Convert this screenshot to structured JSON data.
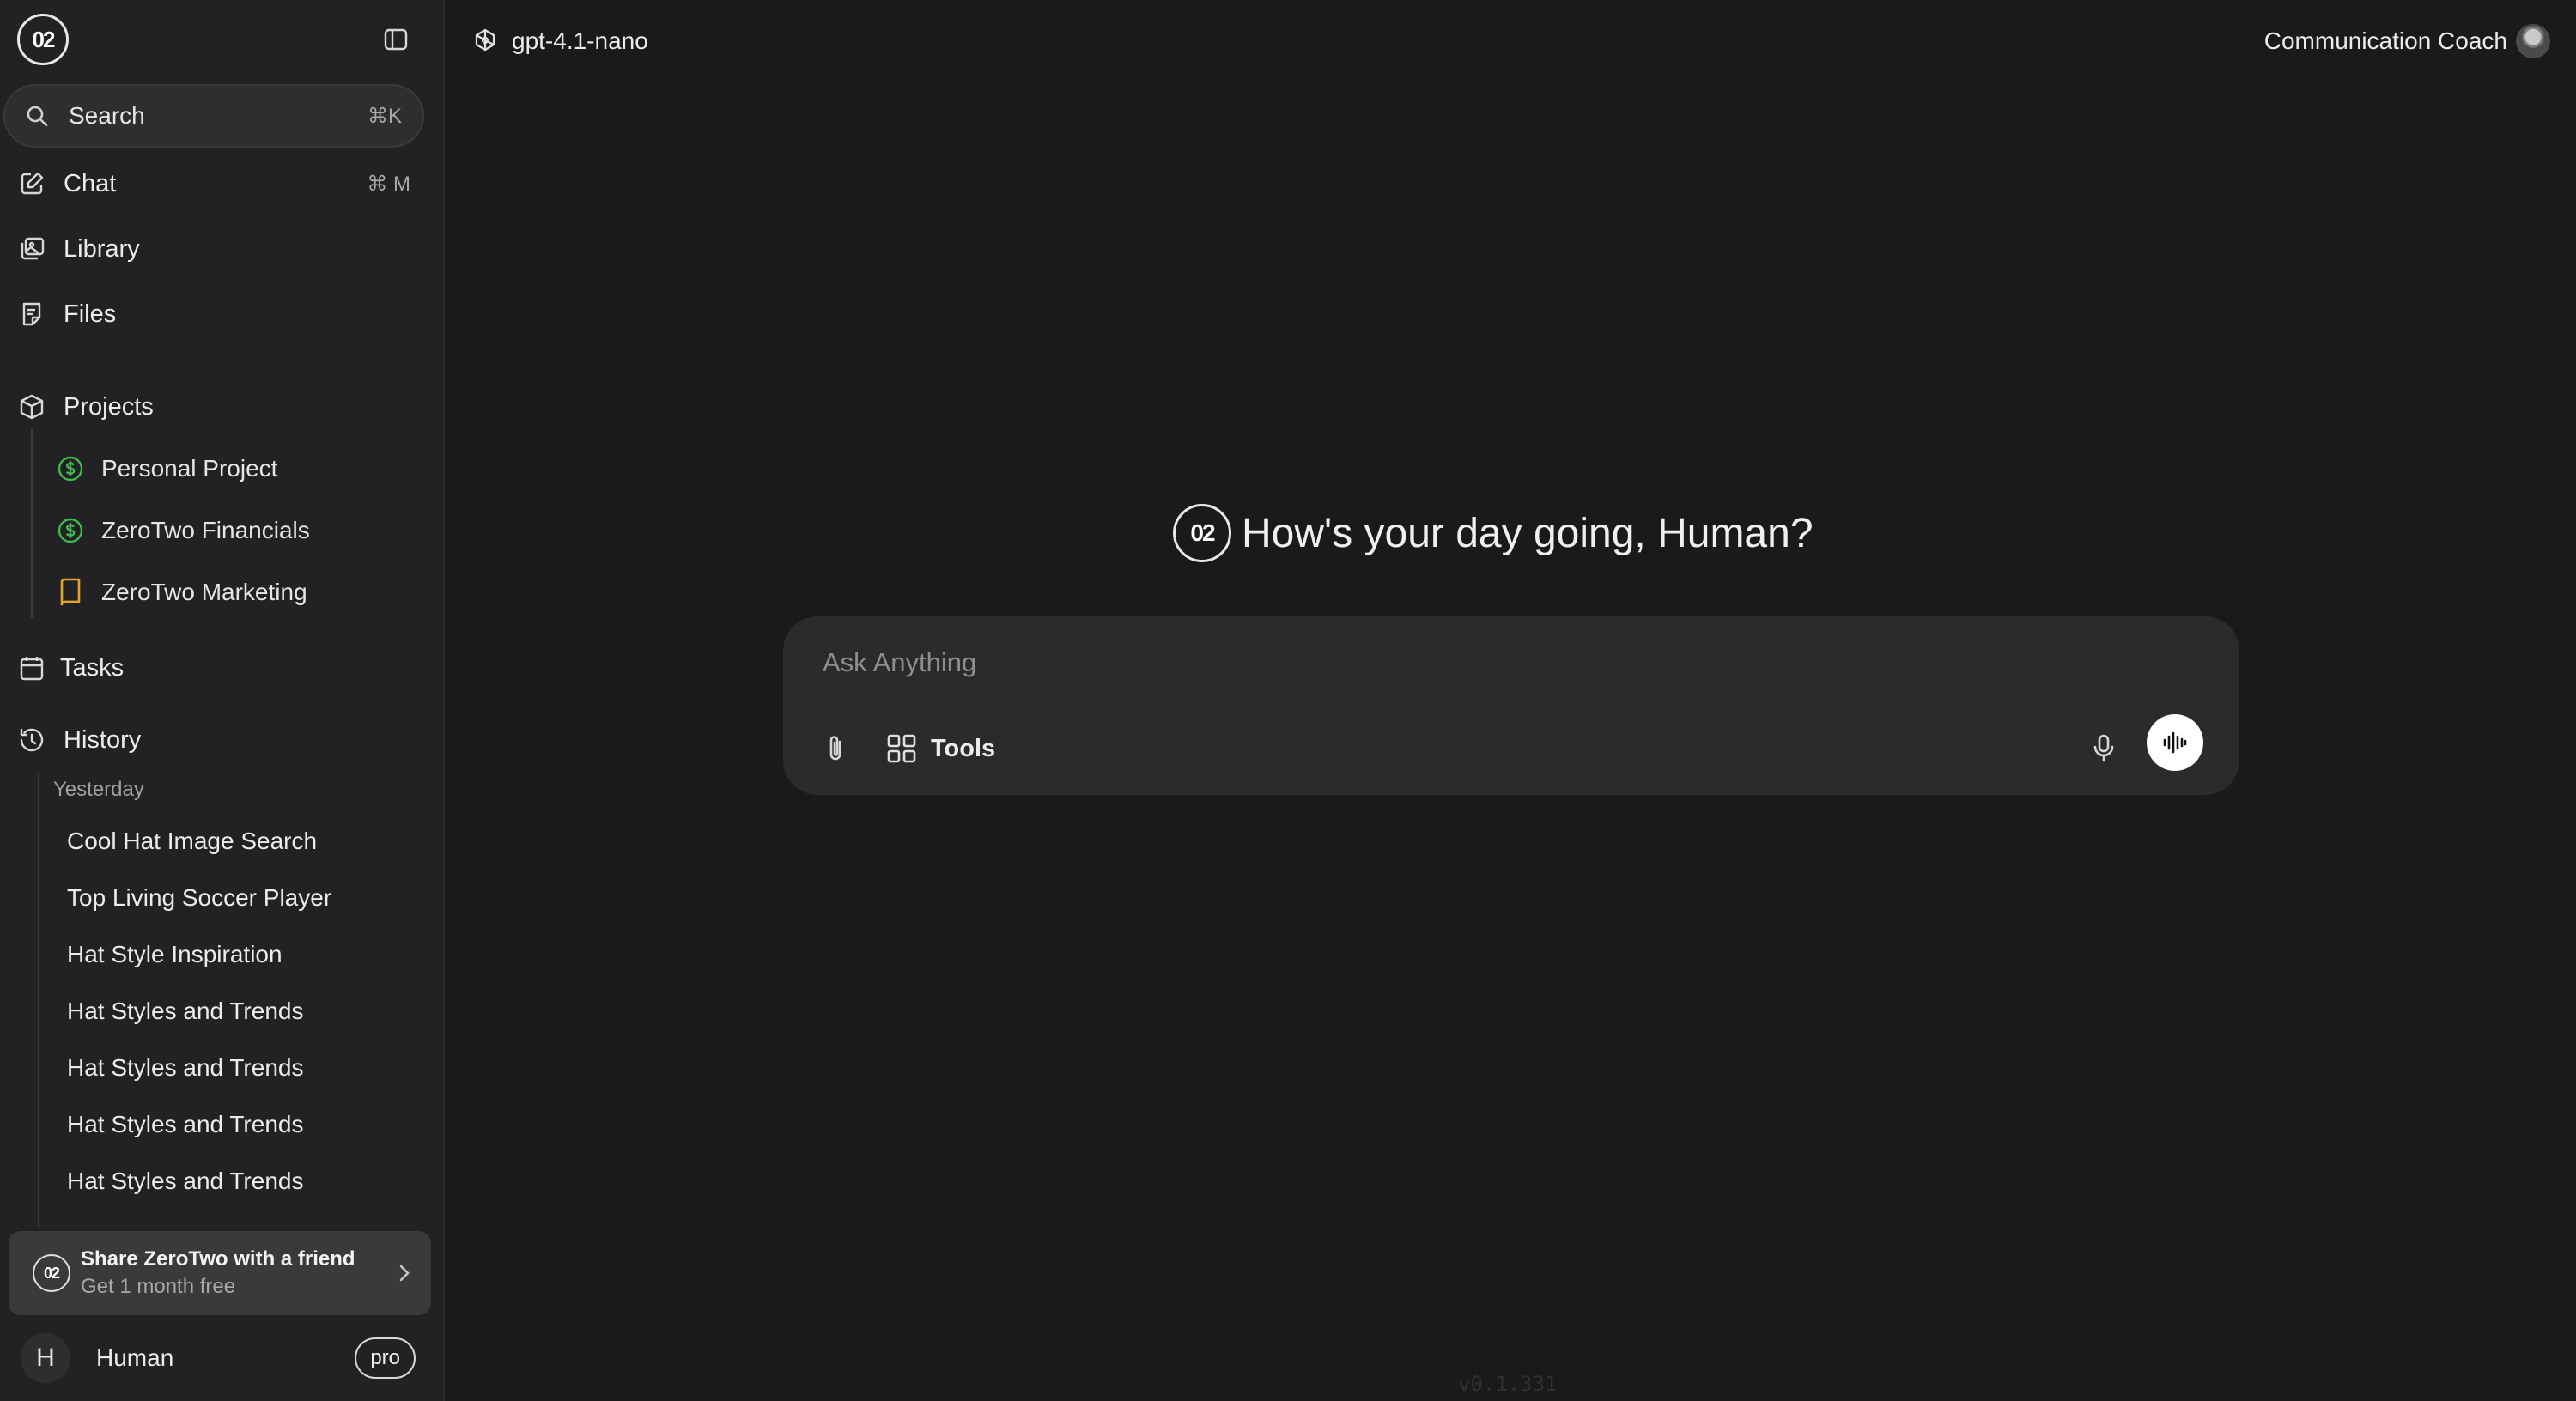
{
  "sidebar": {
    "logo": "02",
    "search": {
      "label": "Search",
      "shortcut": "⌘K"
    },
    "nav": {
      "chat": {
        "label": "Chat",
        "shortcut": "⌘ M"
      },
      "library": {
        "label": "Library"
      },
      "files": {
        "label": "Files"
      },
      "projects": {
        "label": "Projects"
      },
      "tasks": {
        "label": "Tasks"
      },
      "history": {
        "label": "History"
      }
    },
    "projects": [
      {
        "label": "Personal Project",
        "icon": "dollar-circle-icon",
        "color": "#3fb950"
      },
      {
        "label": "ZeroTwo Financials",
        "icon": "dollar-circle-icon",
        "color": "#3fb950"
      },
      {
        "label": "ZeroTwo Marketing",
        "icon": "book-icon",
        "color": "#e3a42b"
      }
    ],
    "history_group": "Yesterday",
    "history": [
      "Cool Hat Image Search",
      "Top Living Soccer Player",
      "Hat Style Inspiration",
      "Hat Styles and Trends",
      "Hat Styles and Trends",
      "Hat Styles and Trends",
      "Hat Styles and Trends"
    ],
    "share": {
      "logo": "02",
      "title": "Share ZeroTwo with a friend",
      "subtitle": "Get 1 month free"
    },
    "user": {
      "initial": "H",
      "name": "Human",
      "plan": "pro"
    }
  },
  "header": {
    "model": "gpt-4.1-nano",
    "persona": "Communication Coach"
  },
  "main": {
    "logo": "02",
    "greeting": "How's your day going, Human?",
    "composer": {
      "placeholder": "Ask Anything",
      "tools_label": "Tools"
    },
    "version": "v0.1.331"
  }
}
